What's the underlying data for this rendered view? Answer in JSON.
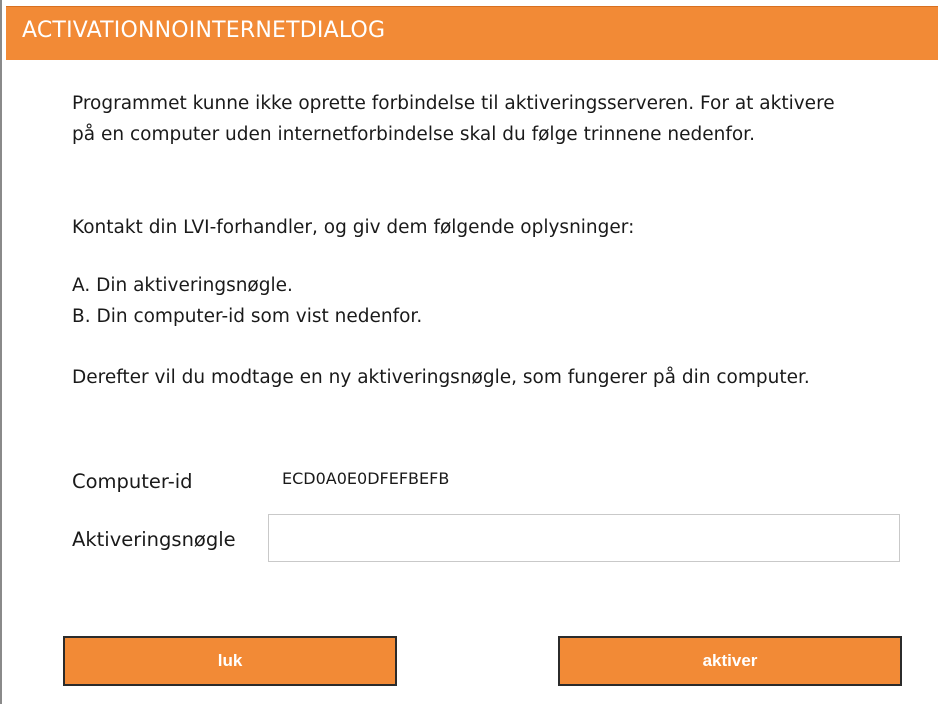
{
  "dialog": {
    "title": "ACTIVATIONNOINTERNETDIALOG",
    "accent_color": "#f28a36"
  },
  "content": {
    "intro": "Programmet kunne ikke oprette forbindelse til aktiveringsserveren. For at aktivere på en computer uden internetforbindelse skal du følge trinnene nedenfor.",
    "contact": "Kontakt din LVI-forhandler, og giv dem følgende oplysninger:",
    "item_a": "A. Din aktiveringsnøgle.",
    "item_b": "B. Din computer-id som vist nedenfor.",
    "after": "Derefter vil du modtage en ny aktiveringsnøgle, som fungerer på din computer."
  },
  "fields": {
    "computer_id_label": "Computer-id",
    "computer_id_value": "ECD0A0E0DFEFBEFB",
    "activation_key_label": "Aktiveringsnøgle",
    "activation_key_value": ""
  },
  "buttons": {
    "close_label": "luk",
    "activate_label": "aktiver"
  }
}
